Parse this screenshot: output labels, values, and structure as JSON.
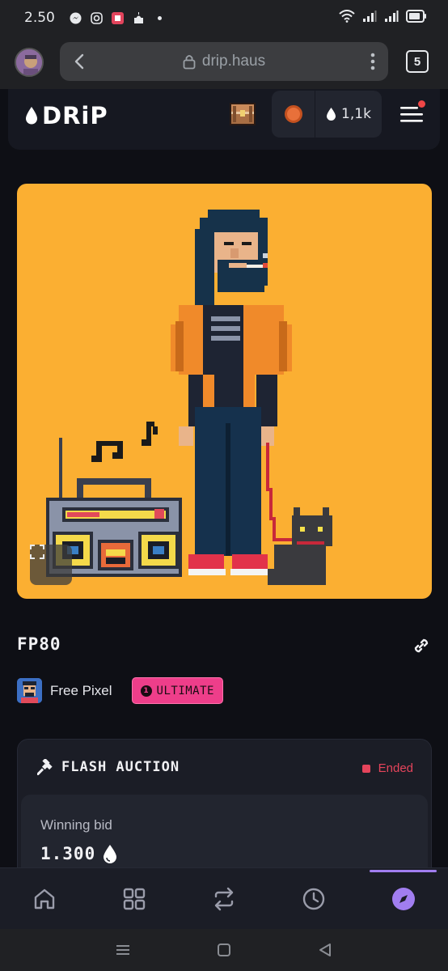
{
  "status_bar": {
    "time": "2.50",
    "icons": [
      "messenger-icon",
      "instagram-icon",
      "app-icon",
      "mosque-icon",
      "dot-icon"
    ],
    "right_icons": [
      "wifi-icon",
      "signal-icon",
      "signal-icon",
      "battery-icon"
    ]
  },
  "browser": {
    "url": "drip.haus",
    "tab_count": "5"
  },
  "header": {
    "logo": "DRiP",
    "drops_balance": "1,1k"
  },
  "nft": {
    "title": "FP80",
    "creator": "Free Pixel",
    "rarity_index": "1",
    "rarity": "ULTIMATE"
  },
  "auction": {
    "title": "FLASH AUCTION",
    "status": "Ended",
    "bid_label": "Winning bid",
    "bid_value": "1.300"
  },
  "bottom_nav": {
    "items": [
      "home",
      "grid",
      "swap",
      "history",
      "explore"
    ],
    "active": "explore"
  },
  "colors": {
    "page_bg": "#0e0f15",
    "card_bg": "#1b1d26",
    "art_bg": "#fbaf32",
    "accent_pink": "#ee3e8a",
    "accent_purple": "#a17ef0",
    "status_red": "#e5445b"
  }
}
